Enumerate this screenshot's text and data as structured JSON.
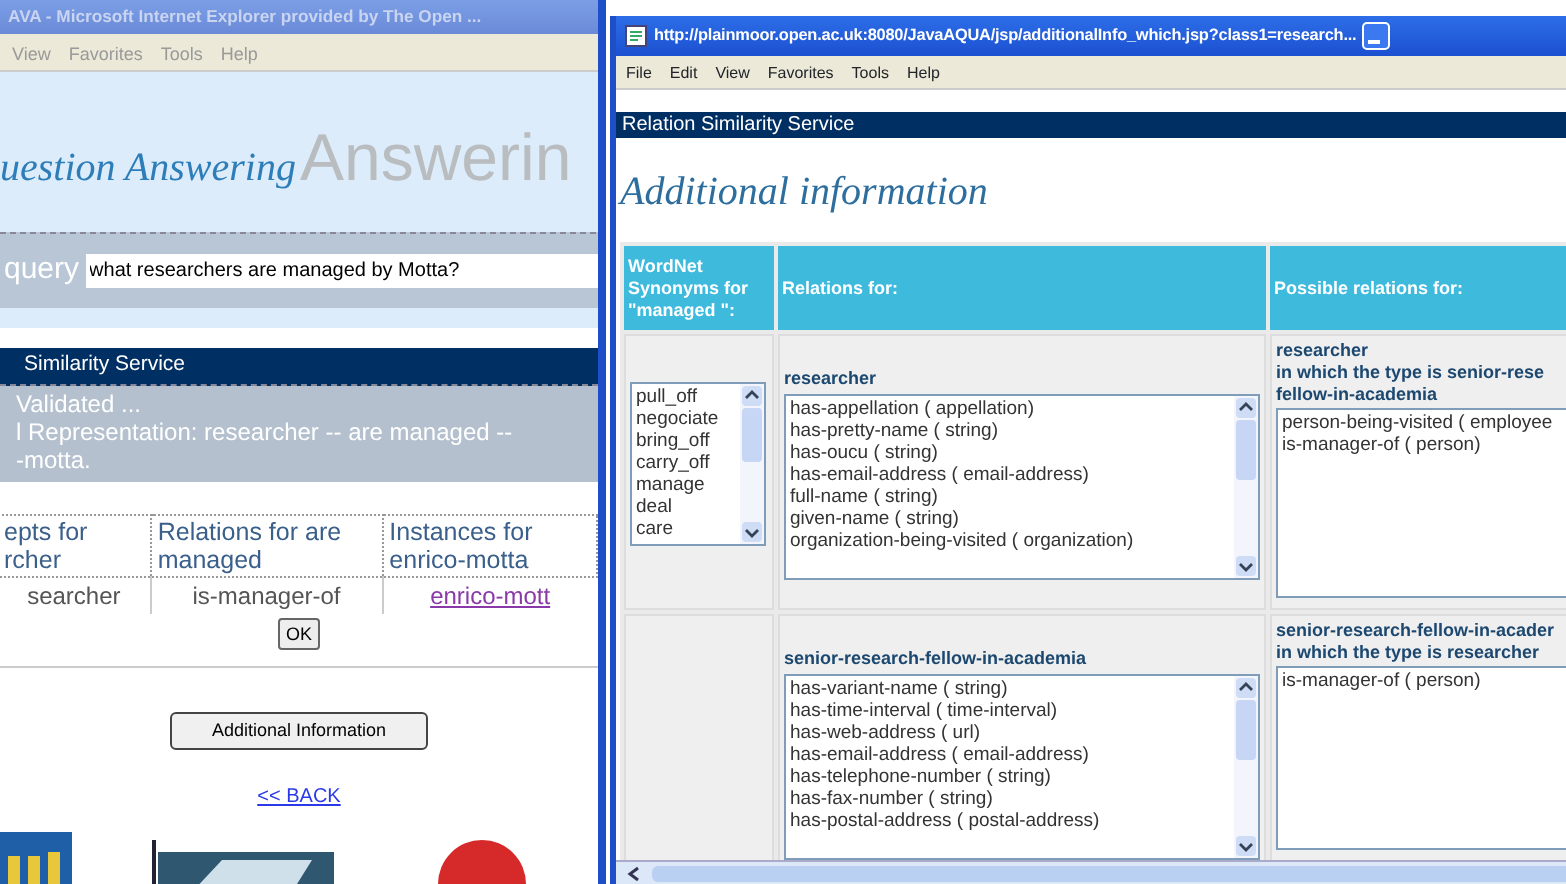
{
  "back_window": {
    "title": "AVA - Microsoft Internet Explorer provided by The Open ...",
    "menu": [
      "View",
      "Favorites",
      "Tools",
      "Help"
    ],
    "banner_title": "uestion Answering",
    "banner_large": "Answerin",
    "query_label": "query",
    "query_value": "what researchers are managed by Motta?",
    "service_bar": "Similarity Service",
    "status_lines": [
      "Validated ...",
      "l Representation: researcher -- are managed --",
      "-motta."
    ],
    "table": {
      "columns": [
        "epts for rcher",
        "Relations for are managed",
        "Instances for enrico-motta"
      ],
      "row": [
        {
          "kind": "text",
          "text": "searcher"
        },
        {
          "kind": "text",
          "text": "is-manager-of"
        },
        {
          "kind": "link",
          "text": "enrico-mott"
        }
      ]
    },
    "ok_button": "OK",
    "info_button": "Additional Information",
    "back_link": "<< BACK"
  },
  "front_window": {
    "title": "http://plainmoor.open.ac.uk:8080/JavaAQUA/jsp/additionalInfo_which.jsp?class1=research...",
    "menu": [
      "File",
      "Edit",
      "View",
      "Favorites",
      "Tools",
      "Help"
    ],
    "service_bar": "Relation Similarity Service",
    "heading": "Additional information",
    "columns": [
      "WordNet Synonyms for \"managed \":",
      "Relations for:",
      "Possible relations for:"
    ],
    "synonyms": [
      "pull_off",
      "negociate",
      "bring_off",
      "carry_off",
      "manage",
      "deal",
      "care"
    ],
    "rows": [
      {
        "relations_label": "researcher",
        "relations": [
          "has-appellation ( appellation)",
          "has-pretty-name ( string)",
          "has-oucu ( string)",
          "has-email-address ( email-address)",
          "full-name ( string)",
          "given-name ( string)",
          "organization-being-visited ( organization)"
        ],
        "possible_labels": [
          "researcher",
          "in which the type is senior-rese",
          "fellow-in-academia"
        ],
        "possible": [
          "person-being-visited ( employee",
          "is-manager-of ( person)"
        ]
      },
      {
        "relations_label": "senior-research-fellow-in-academia",
        "relations": [
          "has-variant-name ( string)",
          "has-time-interval ( time-interval)",
          "has-web-address ( url)",
          "has-email-address ( email-address)",
          "has-telephone-number ( string)",
          "has-fax-number ( string)",
          "has-postal-address ( postal-address)"
        ],
        "possible_labels": [
          "senior-research-fellow-in-acader",
          "in which the type is researcher"
        ],
        "possible": [
          "is-manager-of ( person)"
        ]
      }
    ]
  }
}
